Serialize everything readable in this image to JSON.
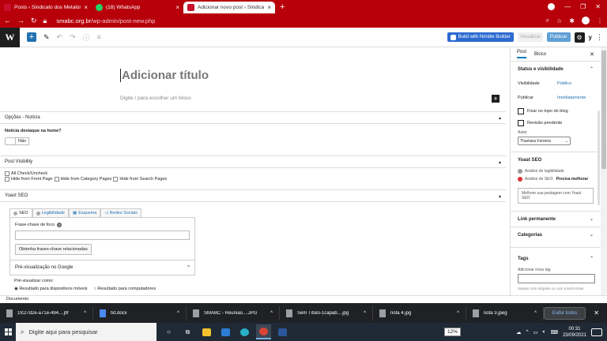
{
  "browser": {
    "tabs": [
      {
        "title": "Posts ‹ Sindicato dos Metalúrgicos",
        "favicon": "site-favicon"
      },
      {
        "title": "(18) WhatsApp",
        "favicon": "whatsapp-icon"
      },
      {
        "title": "Adicionar novo post ‹ Sindicato",
        "favicon": "site-favicon"
      }
    ],
    "new_tab": "+",
    "url_host": "smabc.org.br",
    "url_path": "/wp-admin/post-new.php"
  },
  "wp_toolbar": {
    "build_button": "Build with Nimble Builder",
    "visualize_button": "Visualizar",
    "publish_button": "Publicar",
    "yoast_label": "y"
  },
  "editor": {
    "title_placeholder": "Adicionar título",
    "block_placeholder": "Digite / para escolher um bloco"
  },
  "meta_boxes": {
    "opcoes": {
      "header": "Opções - Notícia",
      "question": "Notícia destaque na home?",
      "toggle_label": "Não"
    },
    "post_visibility": {
      "header": "Post Visibility",
      "check_all": "All Check/Uncheck",
      "options": [
        "Hide from Front Page",
        "Hide from Category Pages",
        "Hide from Search Pages"
      ]
    },
    "yoast": {
      "header": "Yoast SEO",
      "tabs": [
        "SEO",
        "Legibilidade",
        "Esquema",
        "Redes Sociais"
      ],
      "focus_keyphrase": "Frase-chave de foco",
      "related_button": "Obtenha frases-chave relacionadas",
      "google_preview": "Pré-visualização no Google",
      "preview_as": "Pré-visualizar como:",
      "preview_options": [
        "Resultado para dispositivos móveis",
        "Resultado para computadores"
      ]
    }
  },
  "sidebar": {
    "tabs": [
      "Post",
      "Bloco"
    ],
    "status_header": "Status e visibilidade",
    "visibility_label": "Visibilidade",
    "visibility_value": "Público",
    "publish_label": "Publicar",
    "publish_value": "Imediatamente",
    "sticky_label": "Fixar no topo do blog",
    "pending_label": "Revisão pendente",
    "author_label": "Autor",
    "author_value": "Thamara Ferreira",
    "yoast_header": "Yoast SEO",
    "readability": "Análise de legibilidade",
    "seo_analysis_prefix": "Análise de SEO:",
    "seo_analysis_value": "Precisa melhorar",
    "improve_button": "Melhore sua postagem com Yoast SEO",
    "permalink_header": "Link permanente",
    "categories_header": "Categorias",
    "tags_header": "Tags",
    "add_tag_label": "Adicionar nova tag",
    "tag_help": "Separe com vírgulas ou com a tecla Enter."
  },
  "status_bar": "Documento",
  "downloads": [
    {
      "name": "1fc27d2e-a71e-494....jfif",
      "type": "file"
    },
    {
      "name": "txt.docx",
      "type": "doc"
    },
    {
      "name": "SMABC - Reunião....JPG",
      "type": "img"
    },
    {
      "name": "Sem Título-1capab....jpg",
      "type": "img"
    },
    {
      "name": "nota 4.jpg",
      "type": "img"
    },
    {
      "name": "nota 3.jpeg",
      "type": "img"
    }
  ],
  "downloads_show_all": "Exibir todos",
  "taskbar": {
    "search_placeholder": "Digite aqui para pesquisar",
    "zoom": "12%",
    "time": "00:31",
    "date": "23/09/2021"
  },
  "colors": {
    "browser_chrome": "#b7000a",
    "wp_blue": "#2271b1",
    "taskbar": "#1f2a36"
  }
}
